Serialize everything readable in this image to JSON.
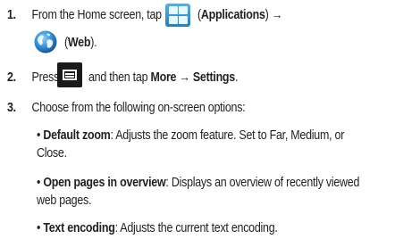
{
  "steps": [
    {
      "number": "1.",
      "pre": "From the Home screen, tap",
      "post_open": "(",
      "bold": "Applications",
      "post_close": ") →",
      "line2_open": "(",
      "line2_bold": "Web",
      "line2_close": ")."
    },
    {
      "number": "2.",
      "pre": "Press",
      "mid": "and then tap",
      "bold": "More → Settings",
      "end": "."
    },
    {
      "number": "3.",
      "text": "Choose from the following on-screen options:"
    }
  ],
  "options": [
    {
      "bullet": "•",
      "name": "Default zoom",
      "line1": ": Adjusts the zoom feature. Set to Far, Medium, or",
      "line2": "Close."
    },
    {
      "bullet": "•",
      "name": "Open pages in overview",
      "line1": ": Displays an overview of recently viewed",
      "line2": "web pages."
    },
    {
      "bullet": "•",
      "name": "Text encoding",
      "line1": ": Adjusts the current text encoding.",
      "line2": ""
    }
  ],
  "icons": {
    "applications": "applications-grid-icon",
    "web": "web-globe-icon",
    "menu": "menu-key-icon"
  },
  "colors": {
    "text": "#231f20",
    "apps_icon": "#2b8fd0",
    "menu_icon": "#1a1a1a"
  }
}
